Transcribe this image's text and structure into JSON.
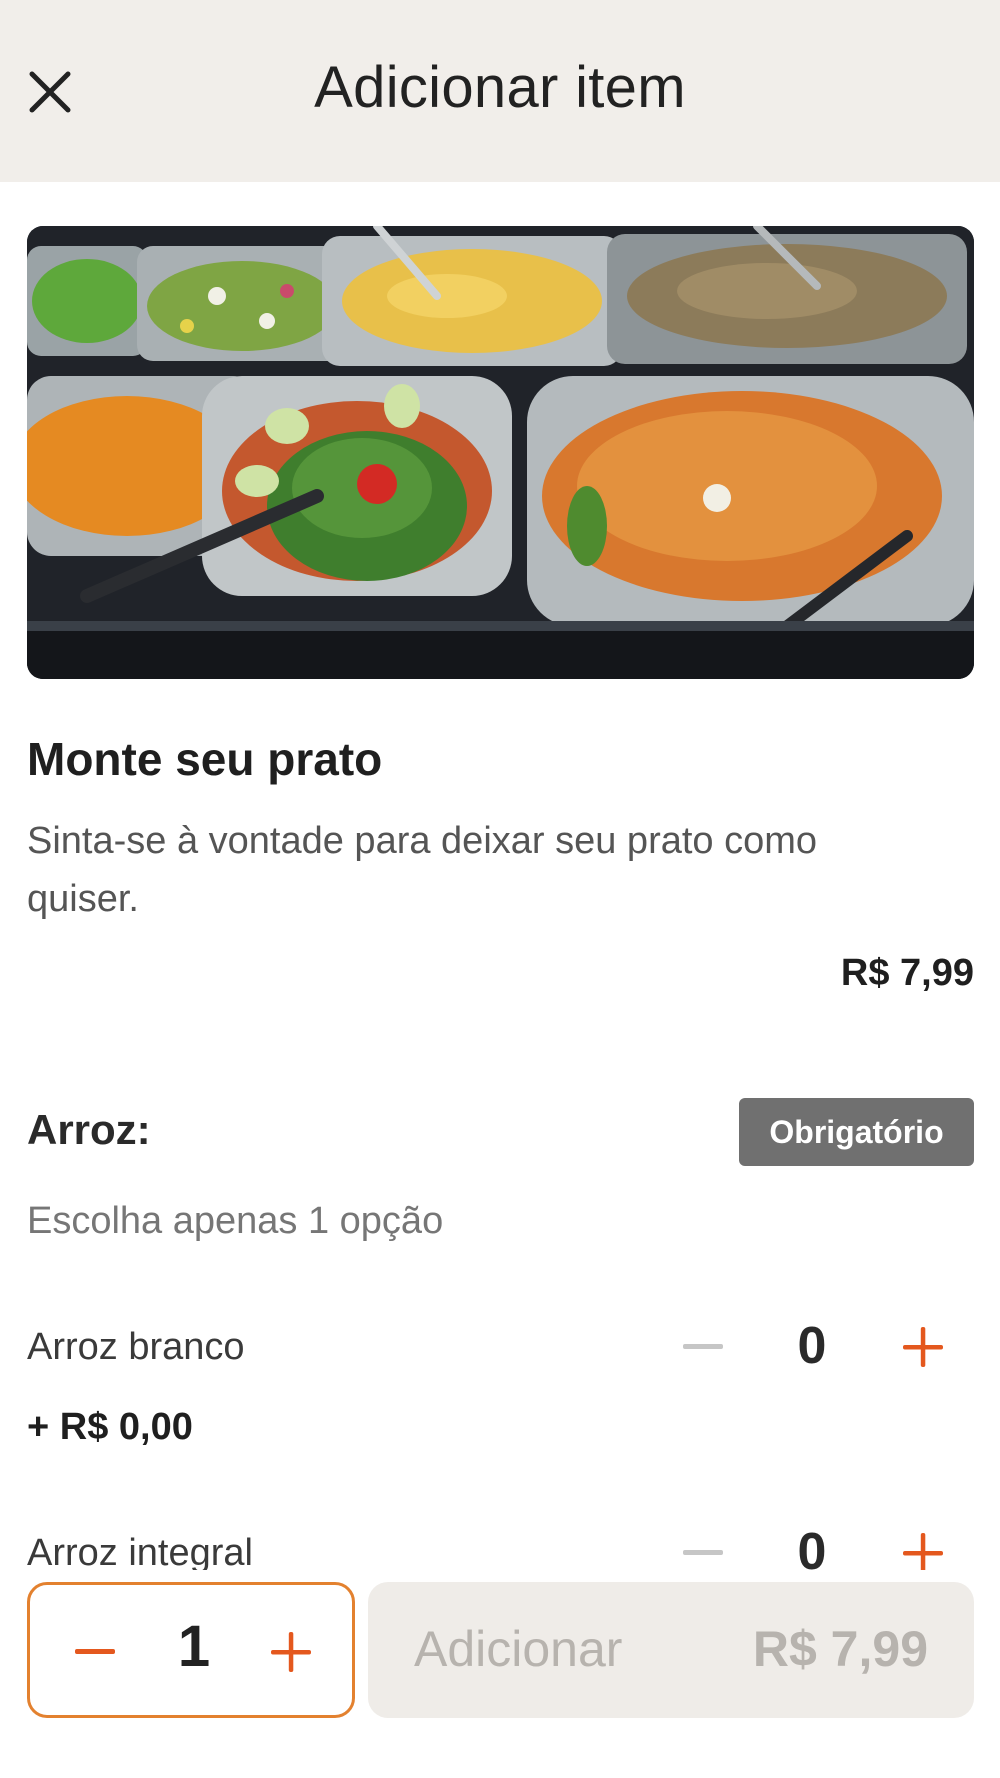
{
  "header": {
    "title": "Adicionar item",
    "close_icon": "close-icon"
  },
  "product": {
    "image_icon": "food-buffet-photo",
    "title": "Monte seu prato",
    "description": "Sinta-se à vontade para deixar seu prato como quiser.",
    "price": "R$ 7,99"
  },
  "section": {
    "title": "Arroz:",
    "badge": "Obrigatório",
    "subtitle": "Escolha apenas 1 opção",
    "options": [
      {
        "name": "Arroz branco",
        "price": "+ R$ 0,00",
        "count": "0"
      },
      {
        "name": "Arroz integral",
        "count": "0"
      }
    ]
  },
  "footer": {
    "quantity": "1",
    "add_label": "Adicionar",
    "add_price": "R$ 7,99"
  },
  "colors": {
    "accent": "#e3812f",
    "plus_icon": "#e4581e",
    "header_bg": "#f1eeea",
    "badge_bg": "#707070",
    "disabled_button_bg": "#efece8"
  }
}
